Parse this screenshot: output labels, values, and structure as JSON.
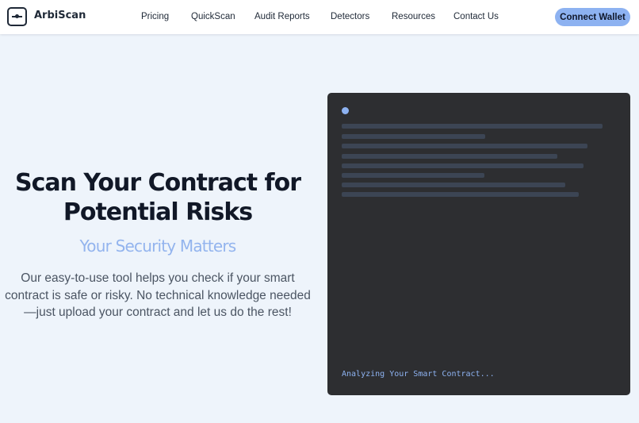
{
  "header": {
    "brand": "ArbiScan",
    "nav": [
      "Pricing",
      "QuickScan",
      "Audit Reports",
      "Detectors",
      "Resources",
      "Contact Us"
    ],
    "connect_label": "Connect Wallet"
  },
  "hero": {
    "title_line1": "Scan Your Contract for",
    "title_line2": "Potential Risks",
    "subtitle": "Your Security Matters",
    "desc_line1": "Our easy-to-use tool helps you check if your smart",
    "desc_line2": "contract is safe or risky. No technical knowledge needed",
    "desc_line3": "—just upload your contract and let us do the rest!"
  },
  "scanner": {
    "status": "Analyzing Your Smart Contract..."
  },
  "colors": {
    "accent": "#8db2f1",
    "background": "#eef4fb",
    "panel": "#2d2e31"
  }
}
